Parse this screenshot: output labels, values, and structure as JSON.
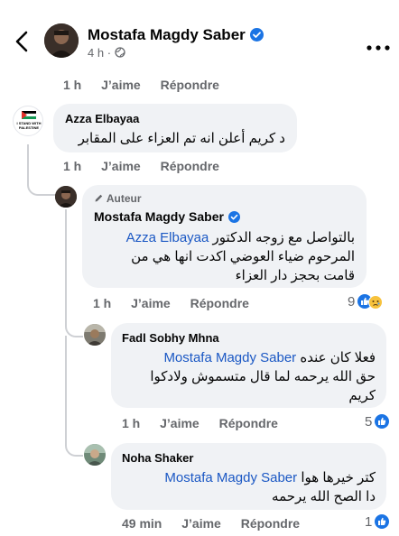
{
  "post": {
    "author": "Mostafa Magdy Saber",
    "time": "4 h",
    "separator": "·"
  },
  "comments": {
    "first_meta": {
      "time": "1 h",
      "like": "J’aime",
      "reply": "Répondre"
    },
    "c1": {
      "author": "Azza Elbayaa",
      "avatar_text": "I STAND WITH PALESTINE",
      "text": "د كريم أعلن انه تم العزاء على المقابر",
      "time": "1 h",
      "like": "J’aime",
      "reply": "Répondre"
    },
    "c2": {
      "badge": "Auteur",
      "author": "Mostafa Magdy Saber",
      "mention": "Azza Elbayaa",
      "text_line1": "بالتواصل مع زوجه الدكتور",
      "text_line2": "المرحوم ضياء العوضي اكدت انها هي من",
      "text_line3": "قامت بحجز دار العزاء",
      "time": "1 h",
      "like": "J’aime",
      "reply": "Répondre",
      "reaction_count": "9"
    },
    "c3": {
      "author": "Fadl Sobhy Mhna",
      "mention": "Mostafa Magdy Saber",
      "text_line1": "فعلا كان عنده",
      "text_line2": "حق الله يرحمه لما قال متسموش ولادكوا",
      "text_line3": "كريم",
      "time": "1 h",
      "like": "J’aime",
      "reply": "Répondre",
      "reaction_count": "5"
    },
    "c4": {
      "author": "Noha Shaker",
      "mention": "Mostafa Magdy Saber",
      "text_line1": "كتر خيرها هوا",
      "text_line2": "دا الصح الله يرحمه",
      "time": "49 min",
      "like": "J’aime",
      "reply": "Répondre",
      "reaction_count": "1"
    }
  },
  "colors": {
    "accent": "#1b74e4",
    "mention": "#1b58c4",
    "bubble": "#f0f2f5",
    "meta": "#65676b"
  }
}
